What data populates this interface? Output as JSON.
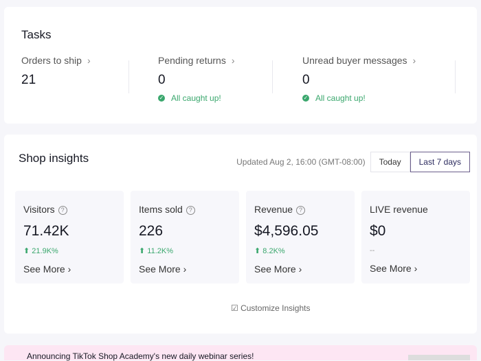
{
  "tasks": {
    "title": "Tasks",
    "items": [
      {
        "label": "Orders to ship",
        "value": "21"
      },
      {
        "label": "Pending returns",
        "value": "0",
        "status": "All caught up!"
      },
      {
        "label": "Unread buyer messages",
        "value": "0",
        "status": "All caught up!"
      }
    ]
  },
  "insights": {
    "title": "Shop insights",
    "updated": "Updated Aug 2, 16:00 (GMT-08:00)",
    "ranges": [
      "Today",
      "Last 7 days"
    ],
    "selected_range": "Last 7 days",
    "metrics": [
      {
        "label": "Visitors",
        "value": "71.42K",
        "change": "21.9K%",
        "more": "See More"
      },
      {
        "label": "Items sold",
        "value": "226",
        "change": "11.2K%",
        "more": "See More"
      },
      {
        "label": "Revenue",
        "value": "$4,596.05",
        "change": "8.2K%",
        "more": "See More"
      },
      {
        "label": "LIVE revenue",
        "value": "$0",
        "change": "--",
        "more": "See More"
      }
    ],
    "customize": "Customize Insights"
  },
  "banner": {
    "text": "Announcing TikTok Shop Academy's new daily webinar series!"
  }
}
